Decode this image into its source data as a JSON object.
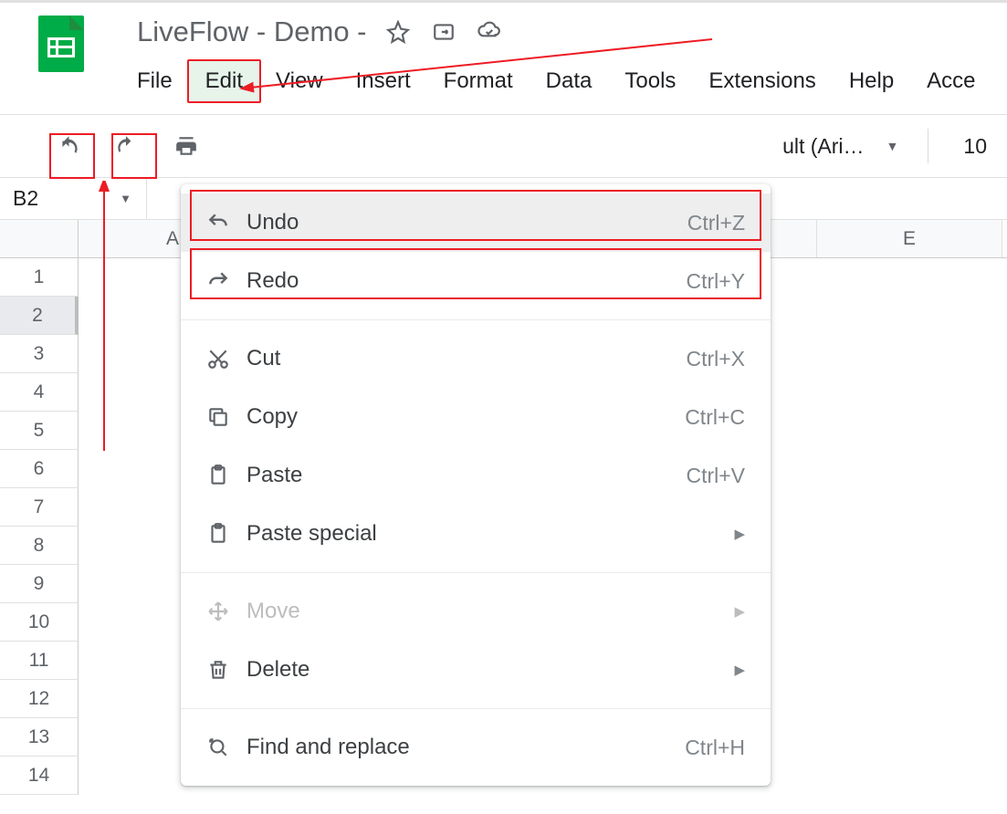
{
  "doc_title": "LiveFlow - Demo -",
  "menu": {
    "file": "File",
    "edit": "Edit",
    "view": "View",
    "insert": "Insert",
    "format": "Format",
    "data": "Data",
    "tools": "Tools",
    "extensions": "Extensions",
    "help": "Help",
    "accessibility": "Acce"
  },
  "toolbar": {
    "font_name": "ult (Ari…",
    "font_size": "10"
  },
  "namebox": "B2",
  "columns": {
    "A": "A",
    "E": "E"
  },
  "rows": [
    "1",
    "2",
    "3",
    "4",
    "5",
    "6",
    "7",
    "8",
    "9",
    "10",
    "11",
    "12",
    "13",
    "14"
  ],
  "edit_menu": {
    "undo": {
      "label": "Undo",
      "shortcut": "Ctrl+Z"
    },
    "redo": {
      "label": "Redo",
      "shortcut": "Ctrl+Y"
    },
    "cut": {
      "label": "Cut",
      "shortcut": "Ctrl+X"
    },
    "copy": {
      "label": "Copy",
      "shortcut": "Ctrl+C"
    },
    "paste": {
      "label": "Paste",
      "shortcut": "Ctrl+V"
    },
    "paste_special": {
      "label": "Paste special"
    },
    "move": {
      "label": "Move"
    },
    "delete": {
      "label": "Delete"
    },
    "find_replace": {
      "label": "Find and replace",
      "shortcut": "Ctrl+H"
    }
  }
}
